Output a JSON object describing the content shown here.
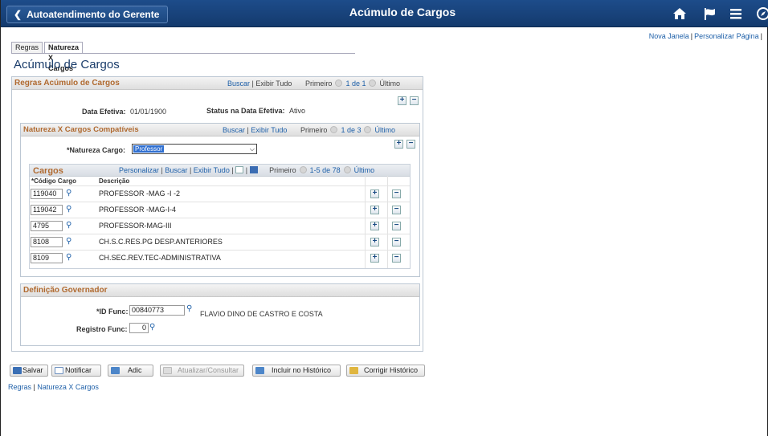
{
  "header": {
    "back_label": "Autoatendimento do Gerente",
    "title": "Acúmulo de Cargos",
    "icons": [
      "home-icon",
      "flag-icon",
      "menu-icon",
      "navbar-icon"
    ]
  },
  "top_links": {
    "new_window": "Nova Janela",
    "personalize": "Personalizar Página"
  },
  "tabs": [
    {
      "label": "Regras",
      "active": false
    },
    {
      "label": "Natureza X Cargos",
      "active": true
    }
  ],
  "page_title": "Acúmulo de Cargos",
  "regras": {
    "title": "Regras Acúmulo de Cargos",
    "find": "Buscar",
    "view_all": "Exibir Tudo",
    "first": "Primeiro",
    "range": "1 de 1",
    "last": "Último",
    "effdt_label": "Data Efetiva:",
    "effdt_value": "01/01/1900",
    "status_label": "Status na Data Efetiva:",
    "status_value": "Ativo"
  },
  "natureza": {
    "title": "Natureza X Cargos Compatíveis",
    "find": "Buscar",
    "view_all": "Exibir Tudo",
    "first": "Primeiro",
    "range": "1 de 3",
    "last": "Último",
    "field_label": "*Natureza Cargo:",
    "field_value": "Professor"
  },
  "cargos": {
    "title": "Cargos",
    "personalize": "Personalizar",
    "find": "Buscar",
    "view_all": "Exibir Tudo",
    "first": "Primeiro",
    "range": "1-5 de 78",
    "last": "Último",
    "col_code": "*Código Cargo",
    "col_desc": "Descrição",
    "rows": [
      {
        "code": "119040",
        "desc": "PROFESSOR -MAG -I -2"
      },
      {
        "code": "119042",
        "desc": "PROFESSOR -MAG-I-4"
      },
      {
        "code": "4795",
        "desc": "PROFESSOR-MAG-III"
      },
      {
        "code": "8108",
        "desc": "CH.S.C.RES.PG DESP.ANTERIORES"
      },
      {
        "code": "8109",
        "desc": "CH.SEC.REV.TEC-ADMINISTRATIVA"
      }
    ]
  },
  "governador": {
    "title": "Definição Governador",
    "id_label": "*ID Func:",
    "id_value": "00840773",
    "name": "FLAVIO DINO DE CASTRO E COSTA",
    "reg_label": "Registro Func:",
    "reg_value": "0"
  },
  "toolbar": {
    "save": "Salvar",
    "notify": "Notificar",
    "add": "Adic",
    "update": "Atualizar/Consultar",
    "include_history": "Incluir no Histórico",
    "correct_history": "Corrigir Histórico"
  },
  "bottom_links": {
    "regras": "Regras",
    "natureza": "Natureza X Cargos"
  }
}
